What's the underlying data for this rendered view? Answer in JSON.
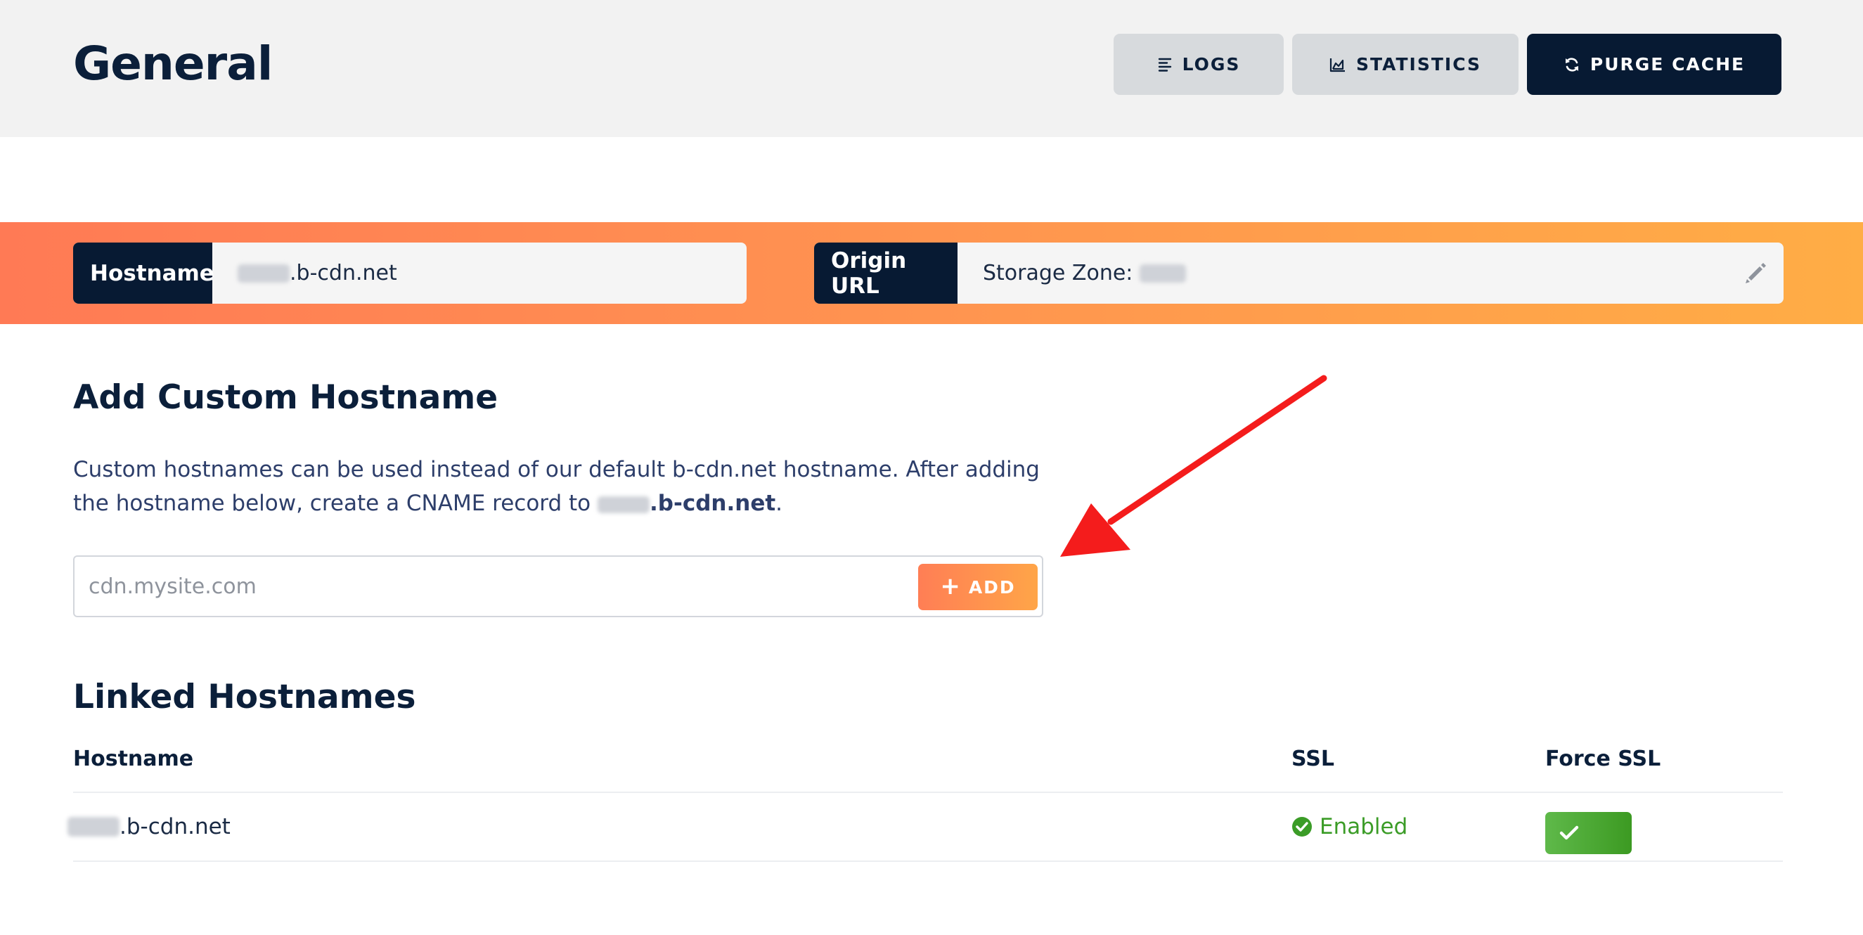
{
  "header": {
    "title": "General",
    "buttons": {
      "logs": "LOGS",
      "statistics": "STATISTICS",
      "purge": "PURGE CACHE"
    }
  },
  "zone": {
    "hostname_label": "Hostname",
    "hostname_suffix": ".b-cdn.net",
    "origin_label": "Origin URL",
    "origin_value_prefix": "Storage Zone:"
  },
  "add_custom": {
    "title": "Add Custom Hostname",
    "description_part1": "Custom hostnames can be used instead of our default b-cdn.net hostname. After adding the hostname below, create a CNAME record to ",
    "description_host_suffix": ".b-cdn.net",
    "description_end": ".",
    "placeholder": "cdn.mysite.com",
    "add_label": "ADD"
  },
  "linked": {
    "title": "Linked Hostnames",
    "columns": [
      "Hostname",
      "SSL",
      "Force SSL"
    ],
    "rows": [
      {
        "hostname_suffix": ".b-cdn.net",
        "ssl": "Enabled",
        "force_ssl": true
      }
    ]
  },
  "icons": {
    "logs": "list-lines-icon",
    "statistics": "area-chart-icon",
    "purge": "refresh-icon",
    "edit": "pencil-icon",
    "add": "plus-icon",
    "ssl_status": "check-circle-icon",
    "toggle": "check-icon",
    "annotation": "red-arrow"
  },
  "colors": {
    "dark": "#071a33",
    "accent_start": "#ff7a55",
    "accent_end": "#ffad45",
    "success": "#3b9c27",
    "annotation": "#f41c1c"
  }
}
